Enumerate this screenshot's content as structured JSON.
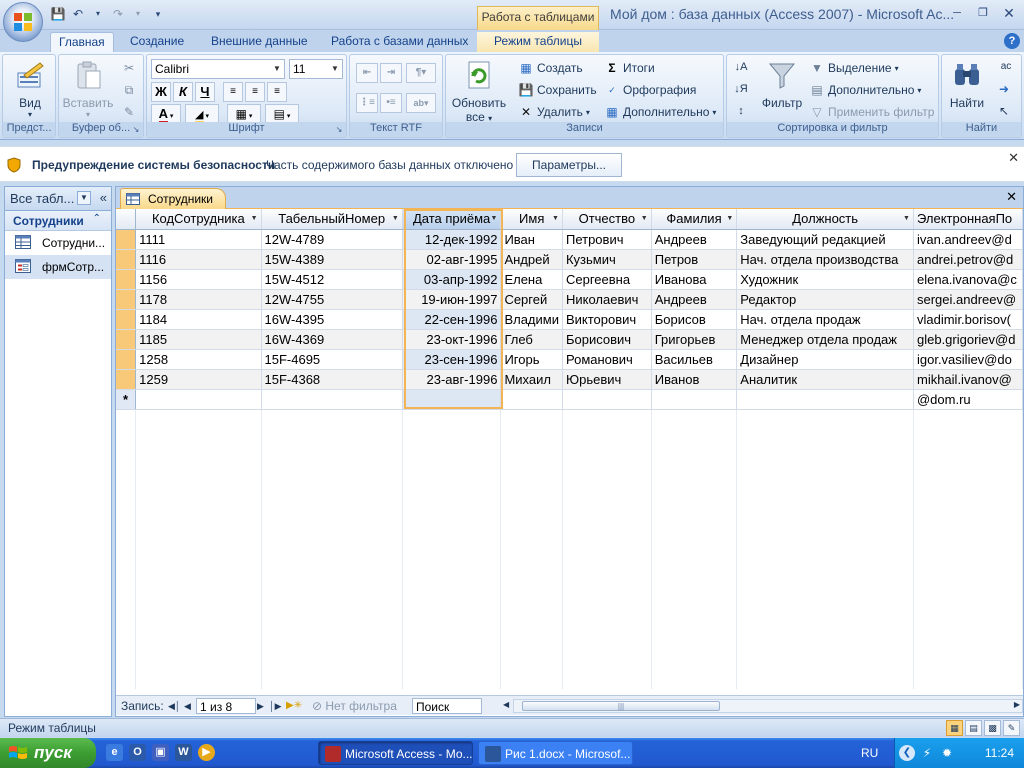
{
  "window": {
    "title": "Мой дом : база данных (Access 2007) - Microsoft Ac...",
    "context_tab_group": "Работа с таблицами"
  },
  "ribbon_tabs": [
    {
      "label": "Главная",
      "active": true
    },
    {
      "label": "Создание"
    },
    {
      "label": "Внешние данные"
    },
    {
      "label": "Работа с базами данных"
    },
    {
      "label": "Режим таблицы",
      "contextual": true
    }
  ],
  "ribbon": {
    "views": {
      "label": "Предст...",
      "view_button": "Вид"
    },
    "clipboard": {
      "label": "Буфер об...",
      "paste": "Вставить"
    },
    "font": {
      "label": "Шрифт",
      "font_name": "Calibri",
      "font_size": "11",
      "bold": "Ж",
      "italic": "К",
      "underline": "Ч"
    },
    "rtf": {
      "label": "Текст RTF"
    },
    "records": {
      "label": "Записи",
      "refresh": "Обновить",
      "refresh2": "все",
      "new": "Создать",
      "save": "Сохранить",
      "delete": "Удалить",
      "totals": "Итоги",
      "spelling": "Орфография",
      "more": "Дополнительно"
    },
    "sort": {
      "label": "Сортировка и фильтр",
      "filter": "Фильтр",
      "selection": "Выделение",
      "advanced": "Дополнительно",
      "toggle": "Применить фильтр"
    },
    "find": {
      "label": "Найти",
      "find": "Найти"
    }
  },
  "security_bar": {
    "title": "Предупреждение системы безопасности",
    "message": "Часть содержимого базы данных отключено",
    "button": "Параметры..."
  },
  "nav_pane": {
    "header": "Все табл...",
    "group": "Сотрудники",
    "items": [
      {
        "label": "Сотрудни...",
        "type": "table"
      },
      {
        "label": "фрмСотр...",
        "type": "form"
      }
    ]
  },
  "object_tab": {
    "label": "Сотрудники"
  },
  "datasheet": {
    "columns": [
      "КодСотрудника",
      "ТабельныйНомер",
      "Дата приёма",
      "Имя",
      "Отчество",
      "Фамилия",
      "Должность",
      "ЭлектроннаяПо"
    ],
    "rows": [
      [
        "1111",
        "12W-4789",
        "12-дек-1992",
        "Иван",
        "Петрович",
        "Андреев",
        "Заведующий редакцией",
        "ivan.andreev@d"
      ],
      [
        "1116",
        "15W-4389",
        "02-авг-1995",
        "Андрей",
        "Кузьмич",
        "Петров",
        "Нач. отдела производства",
        "andrei.petrov@d"
      ],
      [
        "1156",
        "15W-4512",
        "03-апр-1992",
        "Елена",
        "Сергеевна",
        "Иванова",
        "Художник",
        "elena.ivanova@c"
      ],
      [
        "1178",
        "12W-4755",
        "19-июн-1997",
        "Сергей",
        "Николаевич",
        "Андреев",
        "Редактор",
        "sergei.andreev@"
      ],
      [
        "1184",
        "16W-4395",
        "22-сен-1996",
        "Владими",
        "Викторович",
        "Борисов",
        "Нач. отдела продаж",
        "vladimir.borisov("
      ],
      [
        "1185",
        "16W-4369",
        "23-окт-1996",
        "Глеб",
        "Борисович",
        "Григорьев",
        "Менеджер отдела продаж",
        "gleb.grigoriev@d"
      ],
      [
        "1258",
        "15F-4695",
        "23-сен-1996",
        "Игорь",
        "Романович",
        "Васильев",
        "Дизайнер",
        "igor.vasiliev@do"
      ],
      [
        "1259",
        "15F-4368",
        "23-авг-1996",
        "Михаил",
        "Юрьевич",
        "Иванов",
        "Аналитик",
        "mikhail.ivanov@"
      ]
    ],
    "new_row_marker": "*",
    "new_row_email": "@dom.ru"
  },
  "record_nav": {
    "label": "Запись:",
    "position": "1 из 8",
    "filter": "Нет фильтра",
    "search": "Поиск"
  },
  "status_bar": {
    "text": "Режим таблицы"
  },
  "taskbar": {
    "start": "пуск",
    "tasks": [
      "Microsoft Access - Мо...",
      "Рис 1.docx - Microsof..."
    ],
    "lang": "RU",
    "clock": "11:24"
  }
}
